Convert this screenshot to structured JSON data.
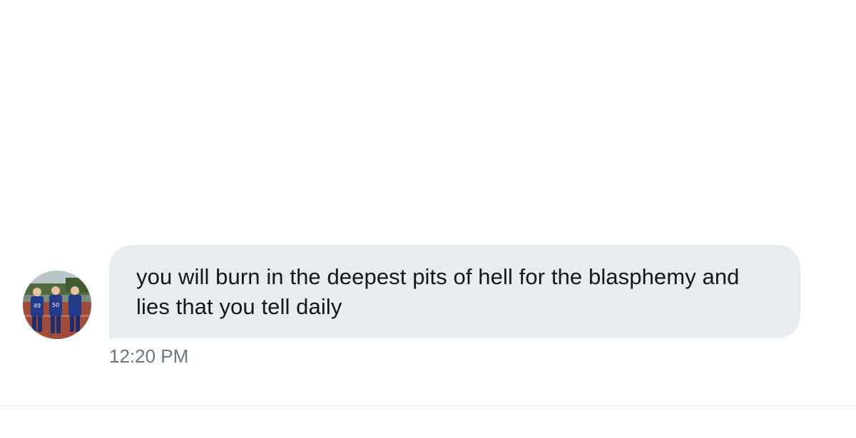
{
  "message": {
    "text": "you will burn in the deepest pits of hell for the blasphemy and lies that you tell daily",
    "timestamp": "12:20 PM",
    "bubble_color": "#e6ecf0",
    "text_color": "#14171a",
    "timestamp_color": "#657786"
  },
  "avatar": {
    "icon": "user-avatar-photo",
    "jersey_numbers": [
      "49",
      "50"
    ]
  }
}
